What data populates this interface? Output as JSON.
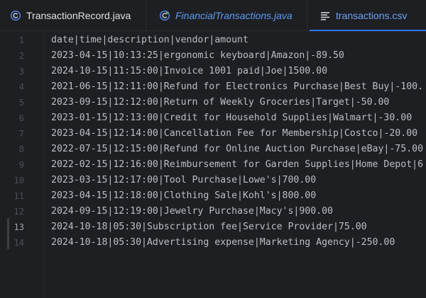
{
  "tabs": [
    {
      "label": "TransactionRecord.java",
      "icon": "java-class-icon",
      "color": "#dfe1e5"
    },
    {
      "label": "FinancialTransactions.java",
      "icon": "java-runnable-class-icon",
      "color": "#5a9bf0"
    },
    {
      "label": "transactions.csv",
      "icon": "text-file-icon",
      "color": "#6aa2f3",
      "active": true
    }
  ],
  "editor": {
    "line_numbers": [
      "1",
      "2",
      "3",
      "4",
      "5",
      "6",
      "7",
      "8",
      "9",
      "10",
      "11",
      "12",
      "13",
      "14"
    ],
    "current_line": "13",
    "lines": [
      "date|time|description|vendor|amount",
      "2023-04-15|10:13:25|ergonomic keyboard|Amazon|-89.50",
      "2024-10-15|11:15:00|Invoice 1001 paid|Joe|1500.00",
      "2021-06-15|12:11:00|Refund for Electronics Purchase|Best Buy|-100.",
      "2023-09-15|12:12:00|Return of Weekly Groceries|Target|-50.00",
      "2023-01-15|12:13:00|Credit for Household Supplies|Walmart|-30.00",
      "2023-04-15|12:14:00|Cancellation Fee for Membership|Costco|-20.00",
      "2022-07-15|12:15:00|Refund for Online Auction Purchase|eBay|-75.00",
      "2022-02-15|12:16:00|Reimbursement for Garden Supplies|Home Depot|6",
      "2023-03-15|12:17:00|Tool Purchase|Lowe's|700.00",
      "2023-04-15|12:18:00|Clothing Sale|Kohl's|800.00",
      "2024-09-15|12:19:00|Jewelry Purchase|Macy's|900.00",
      "2024-10-18|05:30|Subscription fee|Service Provider|75.00",
      "2024-10-18|05:30|Advertising expense|Marketing Agency|-250.00"
    ]
  },
  "colors": {
    "background": "#1e1f22",
    "text": "#bcbec4",
    "line_number": "#4b5059",
    "accent": "#3574f0"
  }
}
